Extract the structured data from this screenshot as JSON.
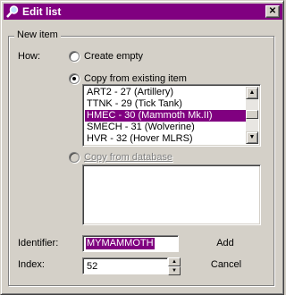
{
  "window": {
    "title": "Edit list",
    "close_glyph": "✕"
  },
  "group": {
    "label": "New item"
  },
  "how": {
    "label": "How:",
    "options": [
      {
        "label": "Create empty",
        "checked": false,
        "disabled": false
      },
      {
        "label": "Copy from existing item",
        "checked": true,
        "disabled": false
      },
      {
        "label": "Copy from database",
        "checked": false,
        "disabled": true
      }
    ]
  },
  "existing_items": {
    "items": [
      "ART2 - 27 (Artillery)",
      "TTNK - 29 (Tick Tank)",
      "HMEC - 30 (Mammoth Mk.II)",
      "SMECH - 31 (Wolverine)",
      "HVR - 32 (Hover MLRS)"
    ],
    "selected_index": 2
  },
  "identifier": {
    "label": "Identifier:",
    "value": "MYMAMMOTH"
  },
  "index": {
    "label": "Index:",
    "value": "52"
  },
  "buttons": {
    "add": "Add",
    "cancel": "Cancel"
  },
  "colors": {
    "titlebar": "#800080",
    "selection": "#800080",
    "face": "#d4d0c8"
  },
  "icons": {
    "title": "magnifier-icon",
    "close": "close-icon"
  }
}
